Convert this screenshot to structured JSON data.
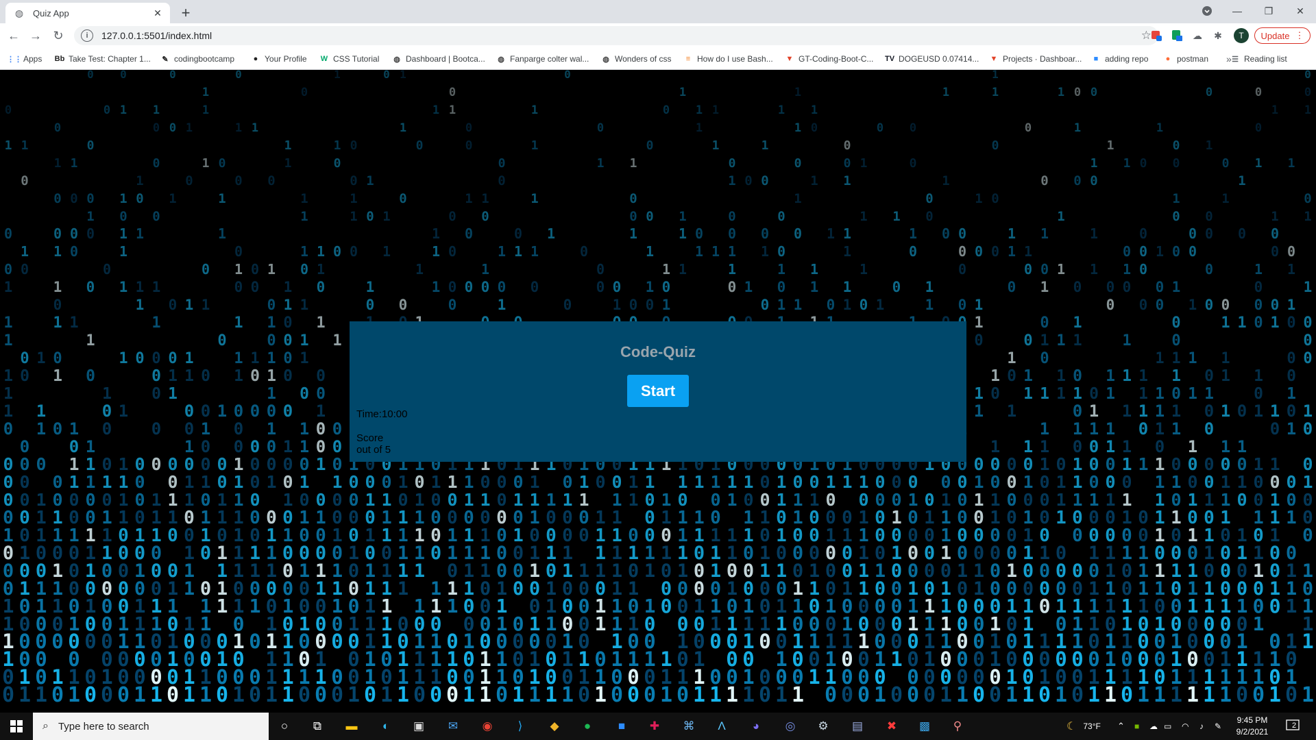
{
  "browser": {
    "tab_title": "Quiz App",
    "url": "127.0.0.1:5501/index.html",
    "update_label": "Update",
    "avatar_letter": "T",
    "bookmarks": [
      {
        "label": "Apps",
        "icon": "apps-grid-icon",
        "color": "#4285f4"
      },
      {
        "label": "Take Test: Chapter 1...",
        "icon": "bb-icon",
        "color": "#222222"
      },
      {
        "label": "codingbootcamp",
        "icon": "pen-icon",
        "color": "#222222"
      },
      {
        "label": "Your Profile",
        "icon": "github-icon",
        "color": "#222222"
      },
      {
        "label": "CSS Tutorial",
        "icon": "w3-icon",
        "color": "#04aa6d"
      },
      {
        "label": "Dashboard | Bootca...",
        "icon": "globe-icon",
        "color": "#444444"
      },
      {
        "label": "Fanparge colter wal...",
        "icon": "globe-icon",
        "color": "#444444"
      },
      {
        "label": "Wonders of css",
        "icon": "globe-icon",
        "color": "#444444"
      },
      {
        "label": "How do I use Bash...",
        "icon": "stackoverflow-icon",
        "color": "#f48024"
      },
      {
        "label": "GT-Coding-Boot-C...",
        "icon": "gitlab-icon",
        "color": "#e24329"
      },
      {
        "label": "DOGEUSD 0.07414...",
        "icon": "tradingview-icon",
        "color": "#131722"
      },
      {
        "label": "Projects · Dashboar...",
        "icon": "gitlab-icon",
        "color": "#e24329"
      },
      {
        "label": "adding repo",
        "icon": "zoom-icon",
        "color": "#2d8cff"
      },
      {
        "label": "postman",
        "icon": "postman-icon",
        "color": "#ff6c37"
      }
    ],
    "reading_list_label": "Reading list"
  },
  "quiz": {
    "title": "Code-Quiz",
    "start_label": "Start",
    "timer_text": "Time:10:00",
    "score_label": "Score",
    "score_suffix": "out of 5"
  },
  "taskbar": {
    "search_placeholder": "Type here to search",
    "weather": "73°F",
    "time": "9:45 PM",
    "date": "9/2/2021",
    "notification_count": "2"
  },
  "colors": {
    "card_bg": "#00486b",
    "start_button_bg": "#0aa1f2",
    "title_color": "#9aa5ad",
    "update_accent": "#d93025"
  }
}
